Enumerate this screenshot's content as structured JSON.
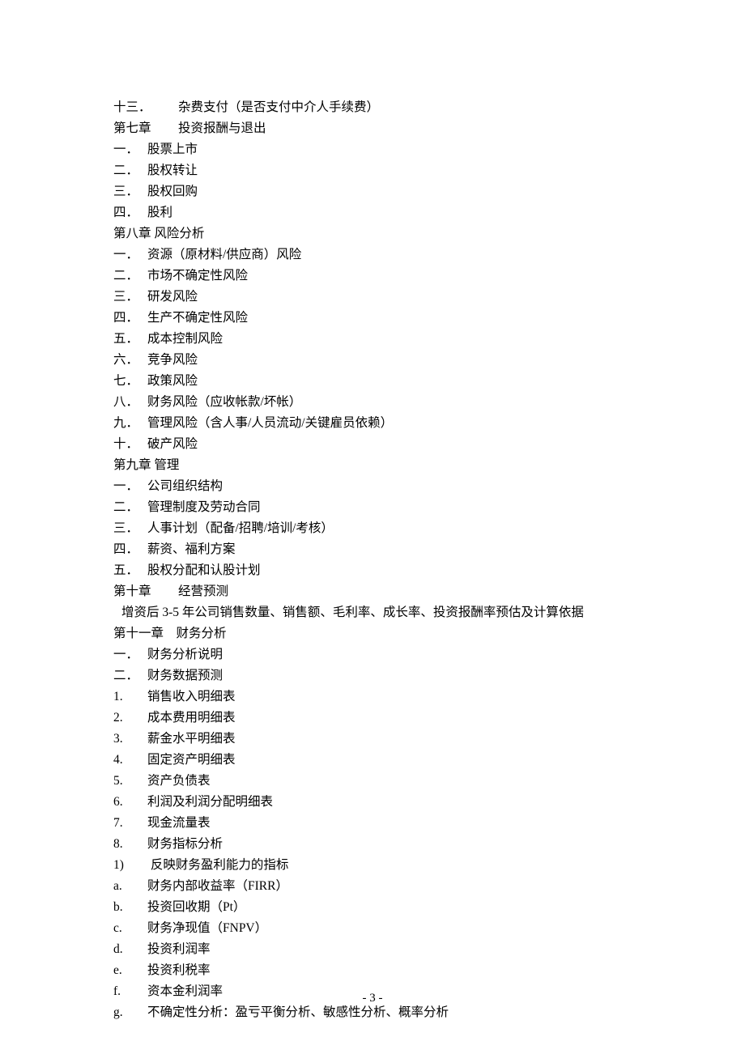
{
  "lines": [
    {
      "marker": "十三．",
      "markerClass": "marker-wide",
      "text": "杂费支付（是否支付中介人手续费）"
    },
    {
      "marker": "第七章",
      "markerClass": "marker-wide",
      "text": "投资报酬与退出"
    },
    {
      "marker": "一．",
      "markerClass": "marker",
      "text": "股票上市"
    },
    {
      "marker": "二．",
      "markerClass": "marker",
      "text": "股权转让"
    },
    {
      "marker": "三．",
      "markerClass": "marker",
      "text": "股权回购"
    },
    {
      "marker": "四．",
      "markerClass": "marker",
      "text": "股利"
    },
    {
      "marker": "第八章",
      "markerClass": "",
      "text": " 风险分析"
    },
    {
      "marker": "一．",
      "markerClass": "marker",
      "text": "资源（原材料/供应商）风险"
    },
    {
      "marker": "二．",
      "markerClass": "marker",
      "text": "市场不确定性风险"
    },
    {
      "marker": "三．",
      "markerClass": "marker",
      "text": "研发风险"
    },
    {
      "marker": "四．",
      "markerClass": "marker",
      "text": "生产不确定性风险"
    },
    {
      "marker": "五．",
      "markerClass": "marker",
      "text": "成本控制风险"
    },
    {
      "marker": "六．",
      "markerClass": "marker",
      "text": "竞争风险"
    },
    {
      "marker": "七．",
      "markerClass": "marker",
      "text": "政策风险"
    },
    {
      "marker": "八．",
      "markerClass": "marker",
      "text": "财务风险（应收帐款/坏帐）"
    },
    {
      "marker": "九．",
      "markerClass": "marker",
      "text": "管理风险（含人事/人员流动/关键雇员依赖）"
    },
    {
      "marker": "十．",
      "markerClass": "marker",
      "text": "破产风险"
    },
    {
      "marker": "第九章",
      "markerClass": "",
      "text": " 管理"
    },
    {
      "marker": "一．",
      "markerClass": "marker",
      "text": "公司组织结构"
    },
    {
      "marker": "二．",
      "markerClass": "marker",
      "text": "管理制度及劳动合同"
    },
    {
      "marker": "三．",
      "markerClass": "marker",
      "text": "人事计划（配备/招聘/培训/考核）"
    },
    {
      "marker": "四．",
      "markerClass": "marker",
      "text": "薪资、福利方案"
    },
    {
      "marker": "五．",
      "markerClass": "marker",
      "text": "股权分配和认股计划"
    },
    {
      "marker": "第十章",
      "markerClass": "marker-wide",
      "text": "经营预测"
    },
    {
      "marker": "",
      "markerClass": "",
      "indent": true,
      "text": "增资后 3-5 年公司销售数量、销售额、毛利率、成长率、投资报酬率预估及计算依据"
    },
    {
      "marker": "第十一章",
      "markerClass": "",
      "text": "　财务分析"
    },
    {
      "marker": "一．",
      "markerClass": "marker",
      "text": "财务分析说明"
    },
    {
      "marker": "二．",
      "markerClass": "marker",
      "text": "财务数据预测"
    },
    {
      "marker": "1.",
      "markerClass": "marker",
      "text": "销售收入明细表"
    },
    {
      "marker": "2.",
      "markerClass": "marker",
      "text": "成本费用明细表"
    },
    {
      "marker": "3.",
      "markerClass": "marker",
      "text": "薪金水平明细表"
    },
    {
      "marker": "4.",
      "markerClass": "marker",
      "text": "固定资产明细表"
    },
    {
      "marker": "5.",
      "markerClass": "marker",
      "text": "资产负债表"
    },
    {
      "marker": "6.",
      "markerClass": "marker",
      "text": "利润及利润分配明细表"
    },
    {
      "marker": "7.",
      "markerClass": "marker",
      "text": "现金流量表"
    },
    {
      "marker": "8.",
      "markerClass": "marker",
      "text": "财务指标分析"
    },
    {
      "marker": "1)",
      "markerClass": "marker",
      "text": " 反映财务盈利能力的指标"
    },
    {
      "marker": "a.",
      "markerClass": "marker",
      "text": "财务内部收益率（FIRR）"
    },
    {
      "marker": "b.",
      "markerClass": "marker",
      "text": "投资回收期（Pt）"
    },
    {
      "marker": "c.",
      "markerClass": "marker",
      "text": "财务净现值（FNPV）"
    },
    {
      "marker": "d.",
      "markerClass": "marker",
      "text": "投资利润率"
    },
    {
      "marker": "e.",
      "markerClass": "marker",
      "text": "投资利税率"
    },
    {
      "marker": "f.",
      "markerClass": "marker",
      "text": "资本金利润率"
    },
    {
      "marker": "g.",
      "markerClass": "marker",
      "text": "不确定性分析：盈亏平衡分析、敏感性分析、概率分析"
    }
  ],
  "pageNumber": "- 3 -"
}
